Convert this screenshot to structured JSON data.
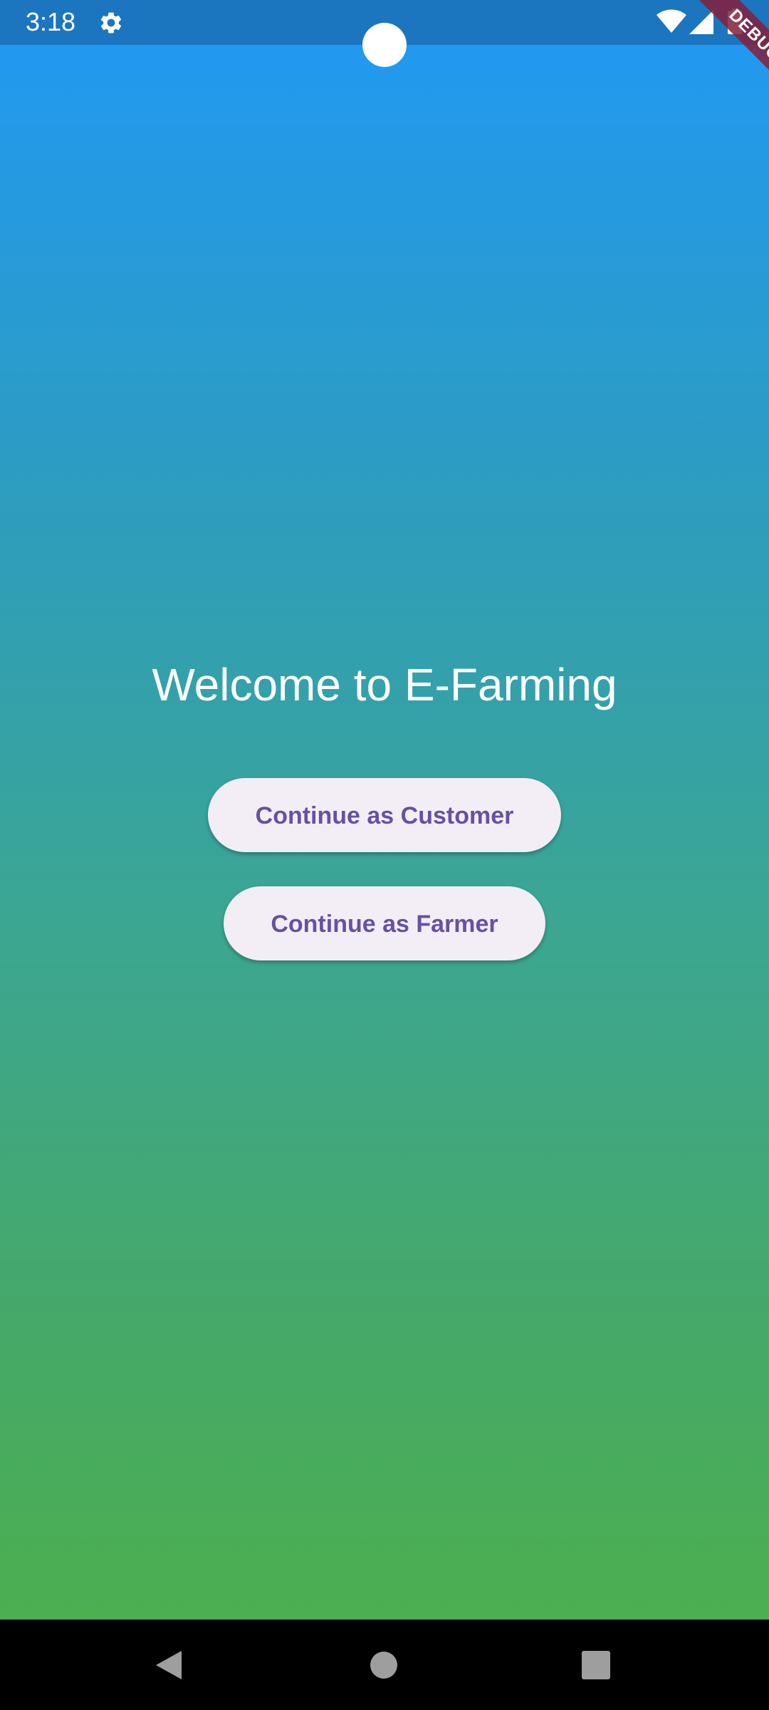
{
  "status_bar": {
    "time": "3:18",
    "icons": [
      "settings-icon",
      "wifi-icon",
      "signal-icon",
      "battery-icon"
    ]
  },
  "debug_banner": {
    "label": "DEBUG"
  },
  "main": {
    "title": "Welcome to E-Farming",
    "customer_button_label": "Continue as Customer",
    "farmer_button_label": "Continue as Farmer"
  },
  "nav_bar": {
    "icons": [
      "back-icon",
      "home-icon",
      "recents-icon"
    ]
  },
  "colors": {
    "status_bar": "#1b76bf",
    "gradient_top": "#2299f0",
    "gradient_bottom": "#4caf50",
    "button_background": "#f3eef6",
    "button_text": "#6750a4",
    "debug_ribbon": "#84203a"
  }
}
